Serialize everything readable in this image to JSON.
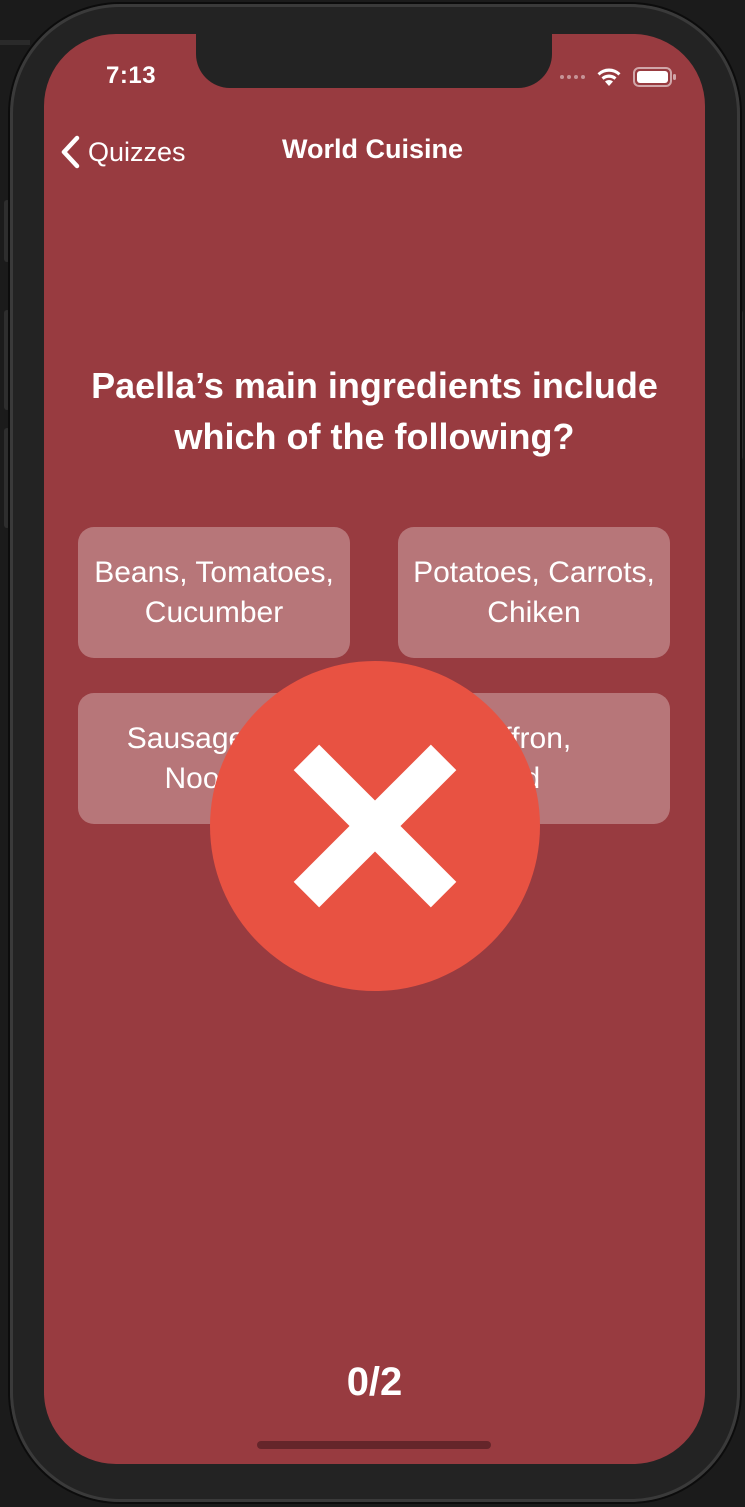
{
  "status_bar": {
    "time": "7:13",
    "icons": [
      "cellular-signal-icon",
      "wifi-icon",
      "battery-icon"
    ]
  },
  "nav": {
    "back_label": "Quizzes",
    "title": "World Cuisine"
  },
  "quiz": {
    "question": "Paella’s main ingredients include which of the following?",
    "answers": [
      {
        "line1": "Beans, Tomatoes,",
        "line2": "Cucumber"
      },
      {
        "line1": "Potatoes, Carrots,",
        "line2": "Chiken"
      },
      {
        "line1": "Sausage",
        "line2": "Noo"
      },
      {
        "line1": "Saffron,",
        "line2": "food"
      }
    ],
    "feedback_icon": "wrong-answer-x-icon",
    "score": "0/2"
  },
  "colors": {
    "background": "#983b40",
    "answer_tile": "rgba(255,255,255,0.30)",
    "feedback_circle": "#e85242",
    "text": "#ffffff"
  }
}
